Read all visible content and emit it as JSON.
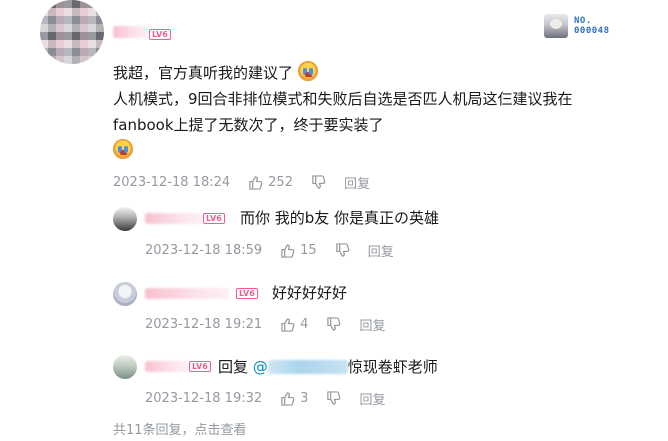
{
  "main_comment": {
    "lines": [
      "我超，官方真听我的建议了",
      "人机模式，9回合非排位模式和失败后自选是否匹人机局这仨建议我在",
      "fanbook上提了无数次了，终于要实装了"
    ],
    "date": "2023-12-18 18:24",
    "likes": "252",
    "reply_label": "回复",
    "fan_badge": {
      "line1": "NO.",
      "line2": "000048"
    }
  },
  "replies": [
    {
      "text": "而你 我的b友 你是真正の英雄",
      "date": "2023-12-18 18:59",
      "likes": "15",
      "reply_label": "回复",
      "level": "LV6"
    },
    {
      "text": "好好好好好",
      "date": "2023-12-18 19:21",
      "likes": "4",
      "reply_label": "回复",
      "level": "LV6"
    },
    {
      "prefix": "回复 ",
      "at": "@",
      "suffix": "惊现卷虾老师",
      "date": "2023-12-18 19:32",
      "likes": "3",
      "reply_label": "回复",
      "level": "LV6"
    }
  ],
  "footer": {
    "count_text": "共11条回复，",
    "click_text": "点击查看"
  },
  "main_level": "LV6",
  "colors": {
    "accent": "#f25d8e",
    "link": "#008ac5",
    "meta": "#9499a0"
  }
}
